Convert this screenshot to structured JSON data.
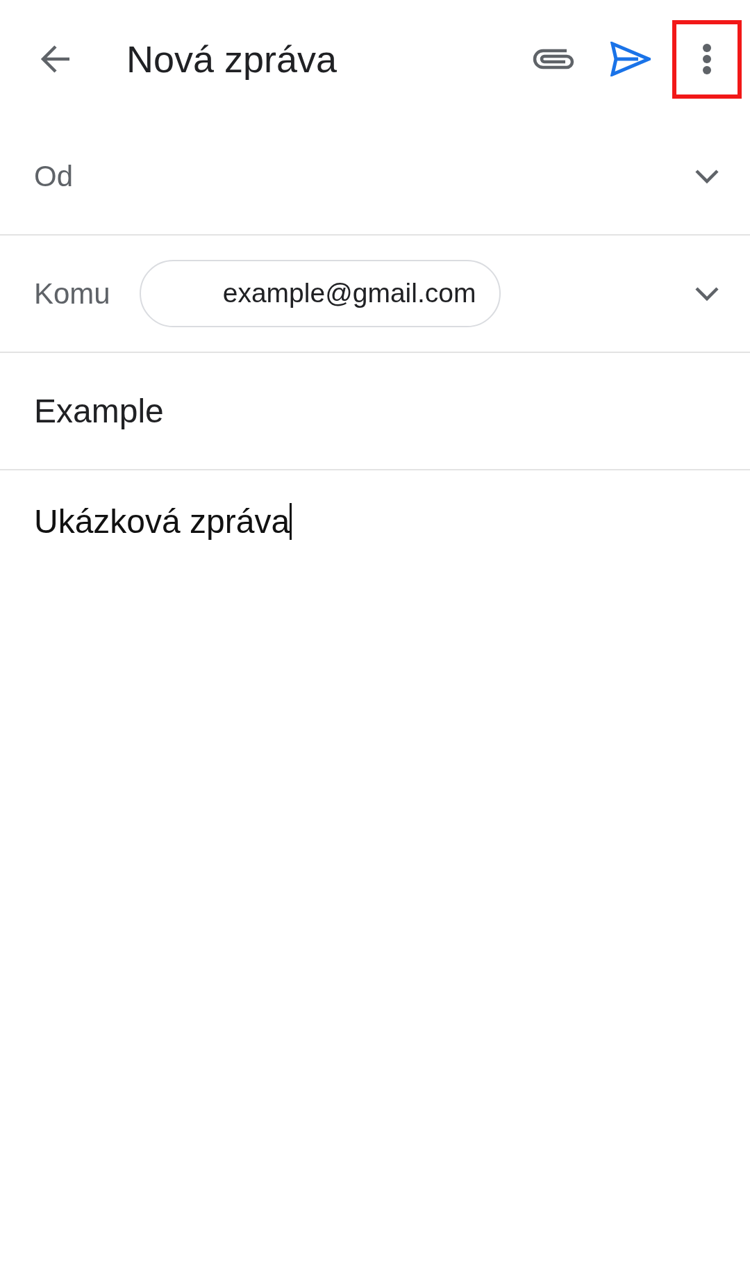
{
  "app_bar": {
    "title": "Nová zpráva",
    "actions": [
      {
        "kind": "attach",
        "highlighted": false
      },
      {
        "kind": "send",
        "highlighted": false
      },
      {
        "kind": "more",
        "highlighted": true
      }
    ]
  },
  "from": {
    "label": "Od"
  },
  "to": {
    "label": "Komu",
    "recipients": [
      "example@gmail.com"
    ]
  },
  "subject": {
    "value": "Example"
  },
  "body": {
    "value": "Ukázková zpráva",
    "cursor": true
  }
}
